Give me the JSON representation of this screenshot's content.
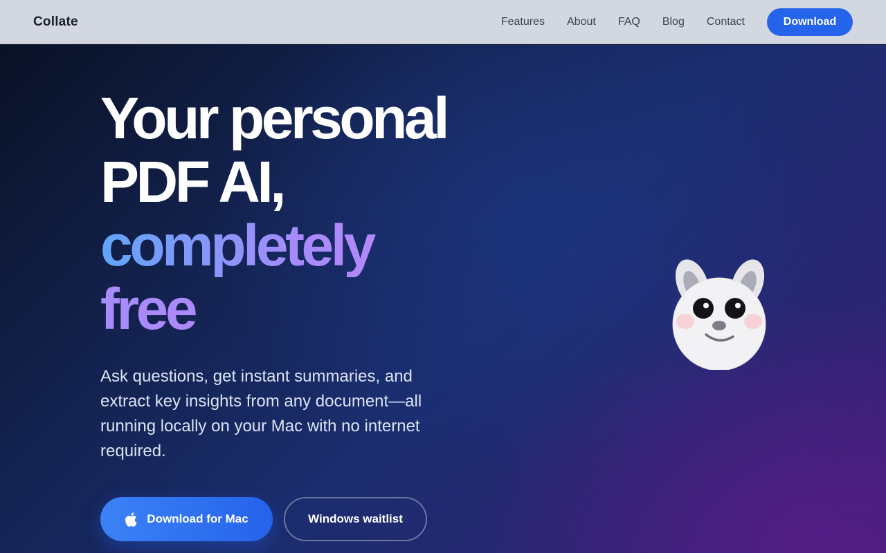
{
  "header": {
    "brand": "Collate",
    "nav": [
      "Features",
      "About",
      "FAQ",
      "Blog",
      "Contact"
    ],
    "download_label": "Download"
  },
  "hero": {
    "headline_line1": "Your personal",
    "headline_line2": "PDF AI,",
    "headline_line3": "completely",
    "headline_line4": "free",
    "subtitle": "Ask questions, get instant summaries, and extract key insights from any document—all running locally on your Mac with no internet required.",
    "primary_cta": "Download for Mac",
    "secondary_cta": "Windows waitlist",
    "primary_icon": "apple-icon",
    "mascot_icon": "bunny-mascot-icon"
  },
  "colors": {
    "accent": "#2563eb",
    "header_bg": "#d3d7df",
    "gradient_start": "#60a5fa",
    "gradient_end": "#c084fc"
  }
}
